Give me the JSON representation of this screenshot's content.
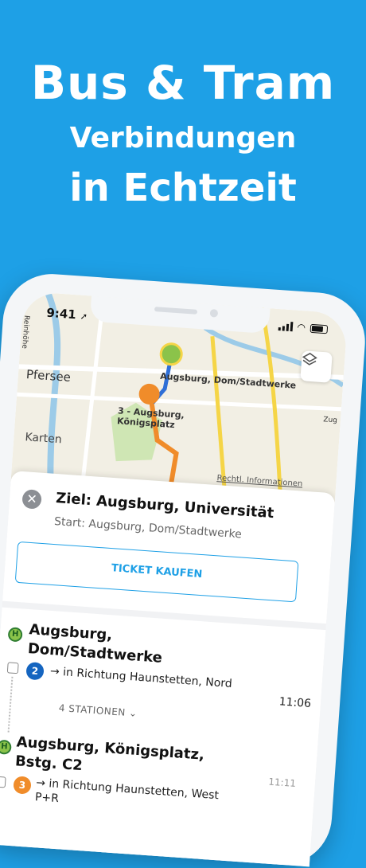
{
  "headline": {
    "line1": "Bus & Tram",
    "line2": "Verbindungen",
    "line3": "in Echtzeit"
  },
  "status": {
    "time": "9:41",
    "arrow": "➚"
  },
  "map": {
    "labels": {
      "pfersee": "Pfersee",
      "dom": "Augsburg, Dom/Stadtwerke",
      "koenigsplatz": "3 - Augsburg,\nKönigsplatz",
      "karten": "Karten",
      "rechtl": "Rechtl. Informationen",
      "reinhold": "Reinhöhe",
      "zug": "Zug"
    },
    "colors": {
      "route_blue": "#2f6fd6",
      "route_orange": "#f08c2a",
      "stop_green": "#8bc34a"
    }
  },
  "route": {
    "close_symbol": "✕",
    "ziel": "Ziel: Augsburg, Universität",
    "start": "Start: Augsburg, Dom/Stadtwerke",
    "ticket_label": "TICKET KAUFEN"
  },
  "steps": [
    {
      "stop": "Augsburg,",
      "stop2": "Dom/Stadtwerke",
      "line": "2",
      "line_color": "#1565c0",
      "direction": "→ in Richtung Haunstetten, Nord",
      "time": "11:06",
      "stations": "4 STATIONEN ⌄"
    },
    {
      "stop": "Augsburg, Königsplatz,",
      "stop2": "Bstg. C2",
      "time_arr": "11:11",
      "line": "3",
      "line_color": "#f08c2a",
      "direction": "→ in Richtung Haunstetten, West",
      "direction2": "P+R"
    }
  ],
  "stop_icon_letter": "H"
}
